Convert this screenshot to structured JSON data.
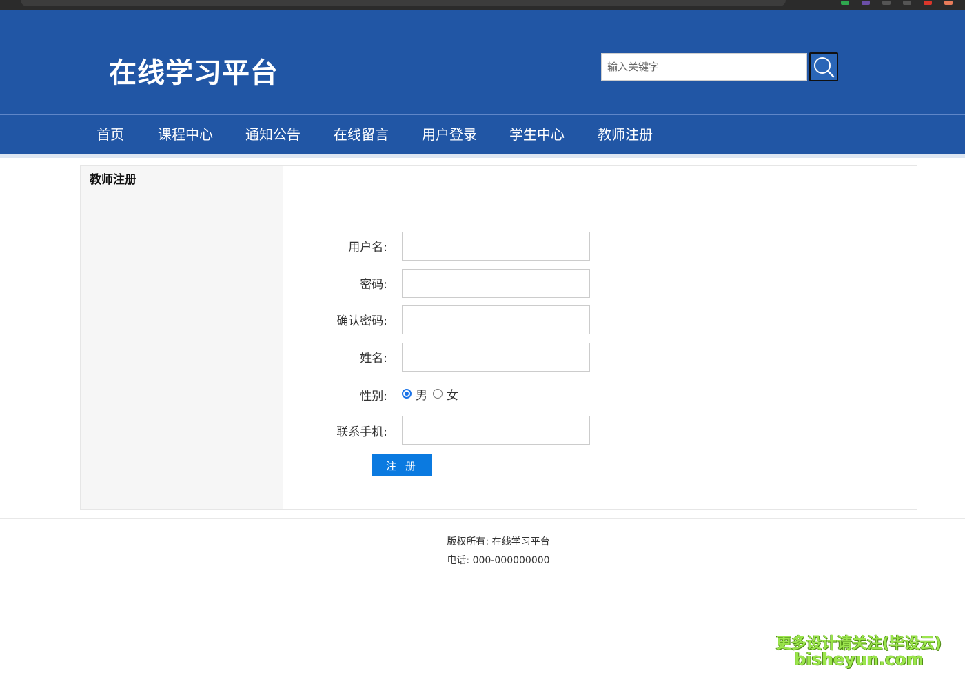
{
  "header": {
    "site_title": "在线学习平台",
    "search_placeholder": "输入关键字",
    "search_icon": "search-icon"
  },
  "nav": {
    "items": [
      {
        "label": "首页"
      },
      {
        "label": "课程中心"
      },
      {
        "label": "通知公告"
      },
      {
        "label": "在线留言"
      },
      {
        "label": "用户登录"
      },
      {
        "label": "学生中心"
      },
      {
        "label": "教师注册"
      }
    ]
  },
  "sidebar": {
    "title": "教师注册"
  },
  "form": {
    "username_label": "用户名:",
    "password_label": "密码:",
    "confirm_password_label": "确认密码:",
    "name_label": "姓名:",
    "gender_label": "性别:",
    "gender_options": [
      "男",
      "女"
    ],
    "gender_selected": "男",
    "phone_label": "联系手机:",
    "submit_label": "注 册"
  },
  "footer": {
    "copyright": "版权所有: 在线学习平台",
    "phone": "电话:  000-000000000"
  },
  "watermark": {
    "line1": "更多设计请关注(毕设云)",
    "line2": "bisheyun.com"
  },
  "colors": {
    "header_bg": "#2156a5",
    "button_blue": "#0b7ae0",
    "radio_blue": "#1a73e8",
    "watermark_green": "#9be54d"
  }
}
